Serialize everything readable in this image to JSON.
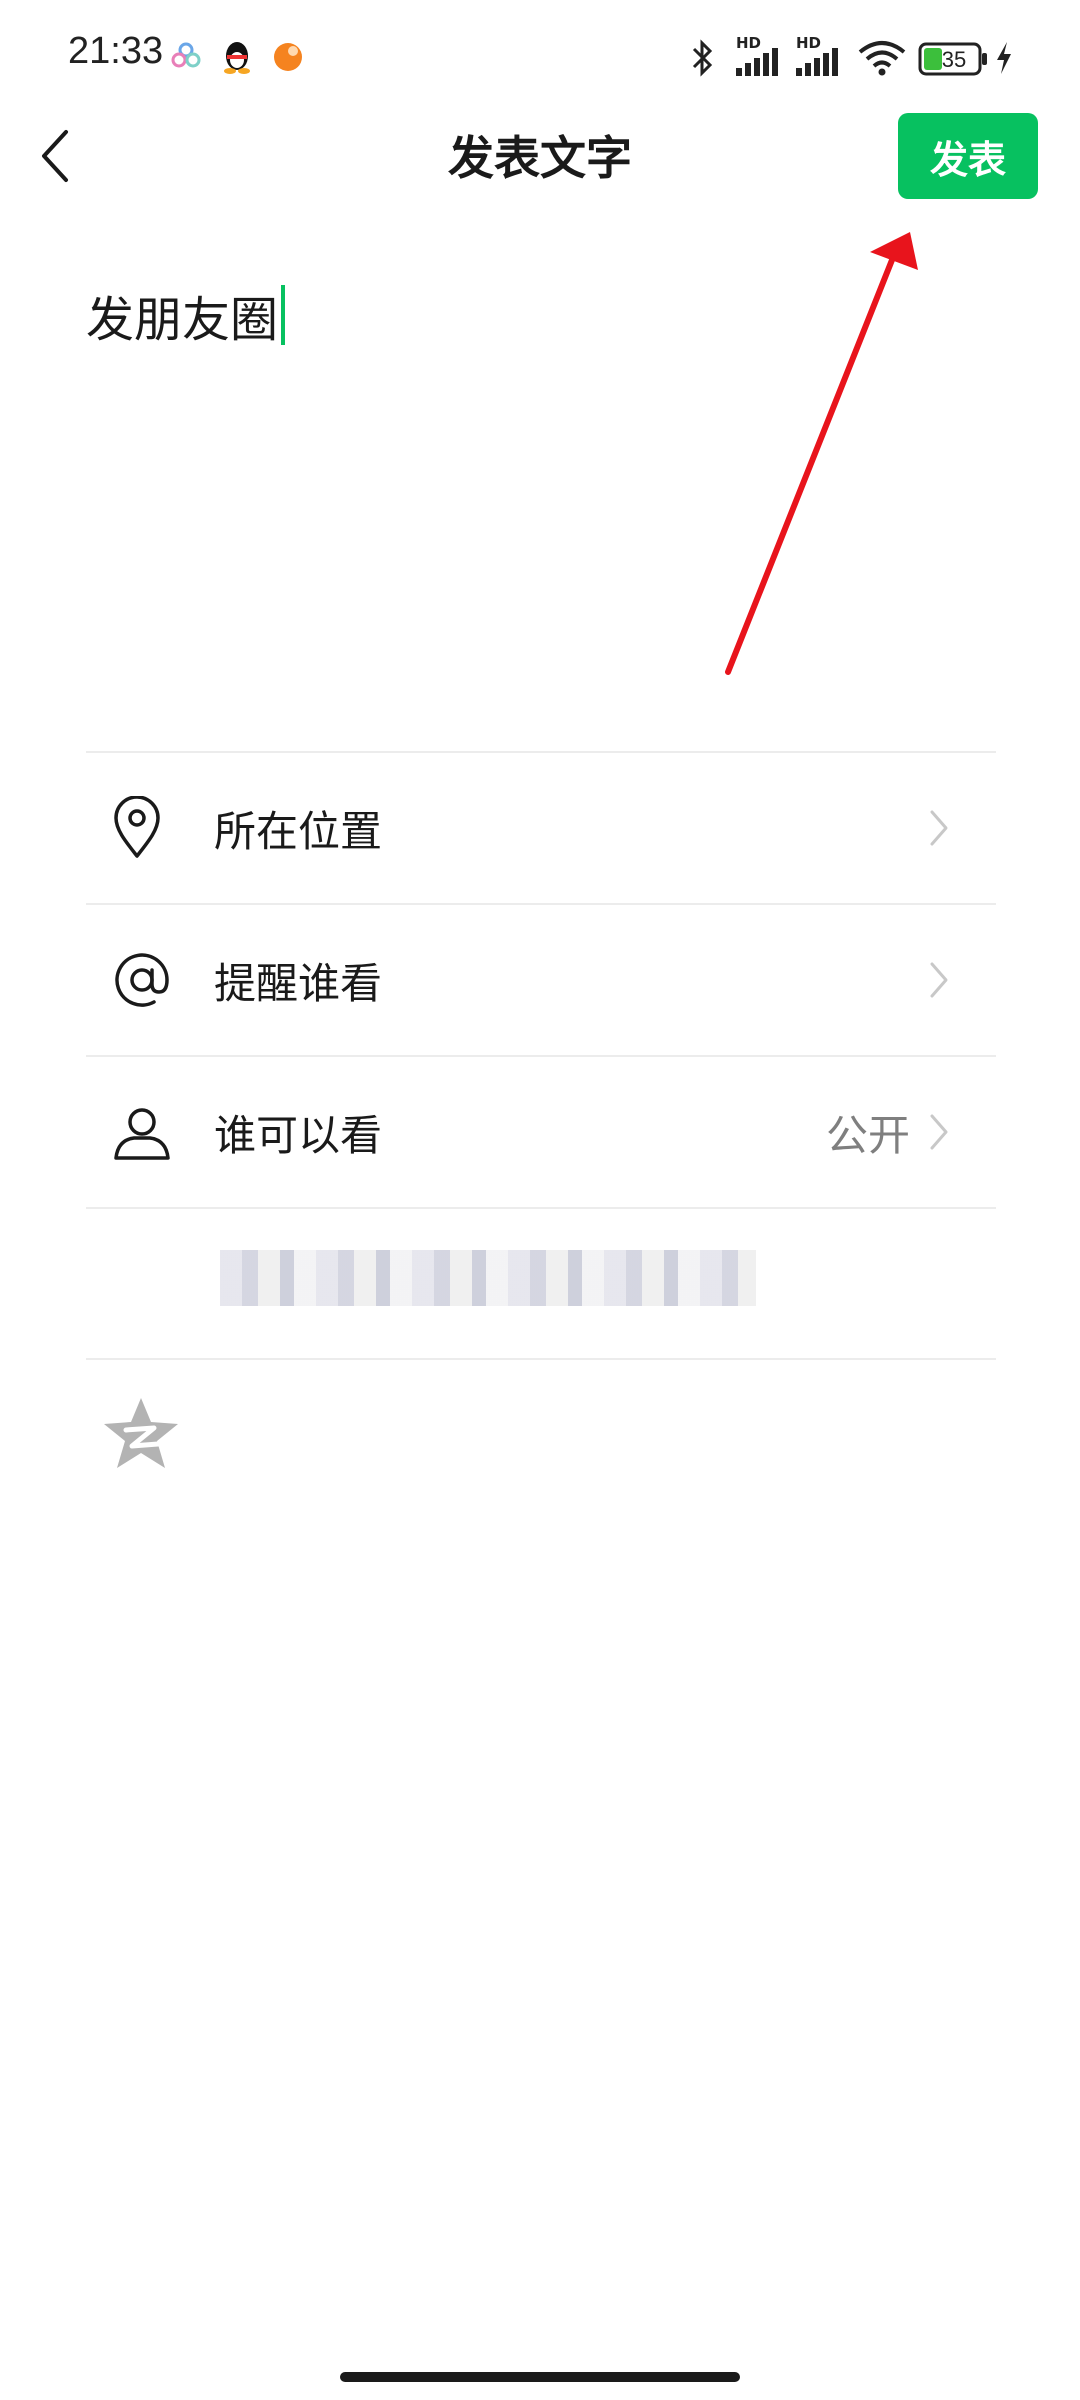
{
  "status_bar": {
    "time": "21:33",
    "battery_level": "35",
    "signal_badge_1": "HD",
    "signal_badge_2": "HD",
    "icons": [
      "cloud-app-icon",
      "qq-icon",
      "orange-app-icon",
      "bluetooth-icon",
      "signal-icon",
      "wifi-icon",
      "battery-icon",
      "charging-icon"
    ]
  },
  "header": {
    "title": "发表文字",
    "publish_label": "发表",
    "back_icon": "chevron-left-icon"
  },
  "composer": {
    "text": "发朋友圈"
  },
  "options": {
    "location": {
      "label": "所在位置",
      "icon": "location-pin-icon"
    },
    "remind": {
      "label": "提醒谁看",
      "icon": "at-sign-icon"
    },
    "visibility": {
      "label": "谁可以看",
      "value": "公开",
      "icon": "user-icon"
    }
  },
  "share": {
    "icon": "qzone-star-icon"
  },
  "colors": {
    "accent": "#07c160",
    "annotation_arrow": "#e8141c",
    "divider": "#ececec",
    "secondary_text": "#7f7f7f"
  }
}
